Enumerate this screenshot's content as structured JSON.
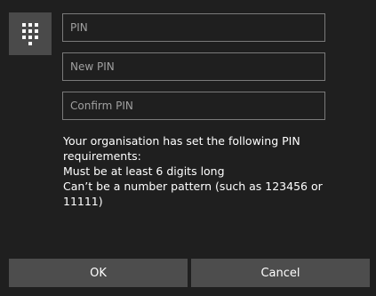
{
  "dialog": {
    "icon": "keypad-icon",
    "fields": {
      "pin_placeholder": "PIN",
      "new_pin_placeholder": "New PIN",
      "confirm_pin_placeholder": "Confirm PIN",
      "pin_value": "",
      "new_pin_value": "",
      "confirm_pin_value": ""
    },
    "requirements": {
      "intro": "Your organisation has set the following PIN requirements:",
      "rule_1": "Must be at least 6 digits long",
      "rule_2": "Can’t be a number pattern (such as 123456 or 11111)"
    },
    "buttons": {
      "ok_label": "OK",
      "cancel_label": "Cancel"
    }
  },
  "colors": {
    "background": "#1f1f1f",
    "tile": "#4a4a4a",
    "field_border": "#7a7a7a",
    "button": "#4d4d4d",
    "text": "#ffffff",
    "placeholder": "#a0a0a0"
  }
}
